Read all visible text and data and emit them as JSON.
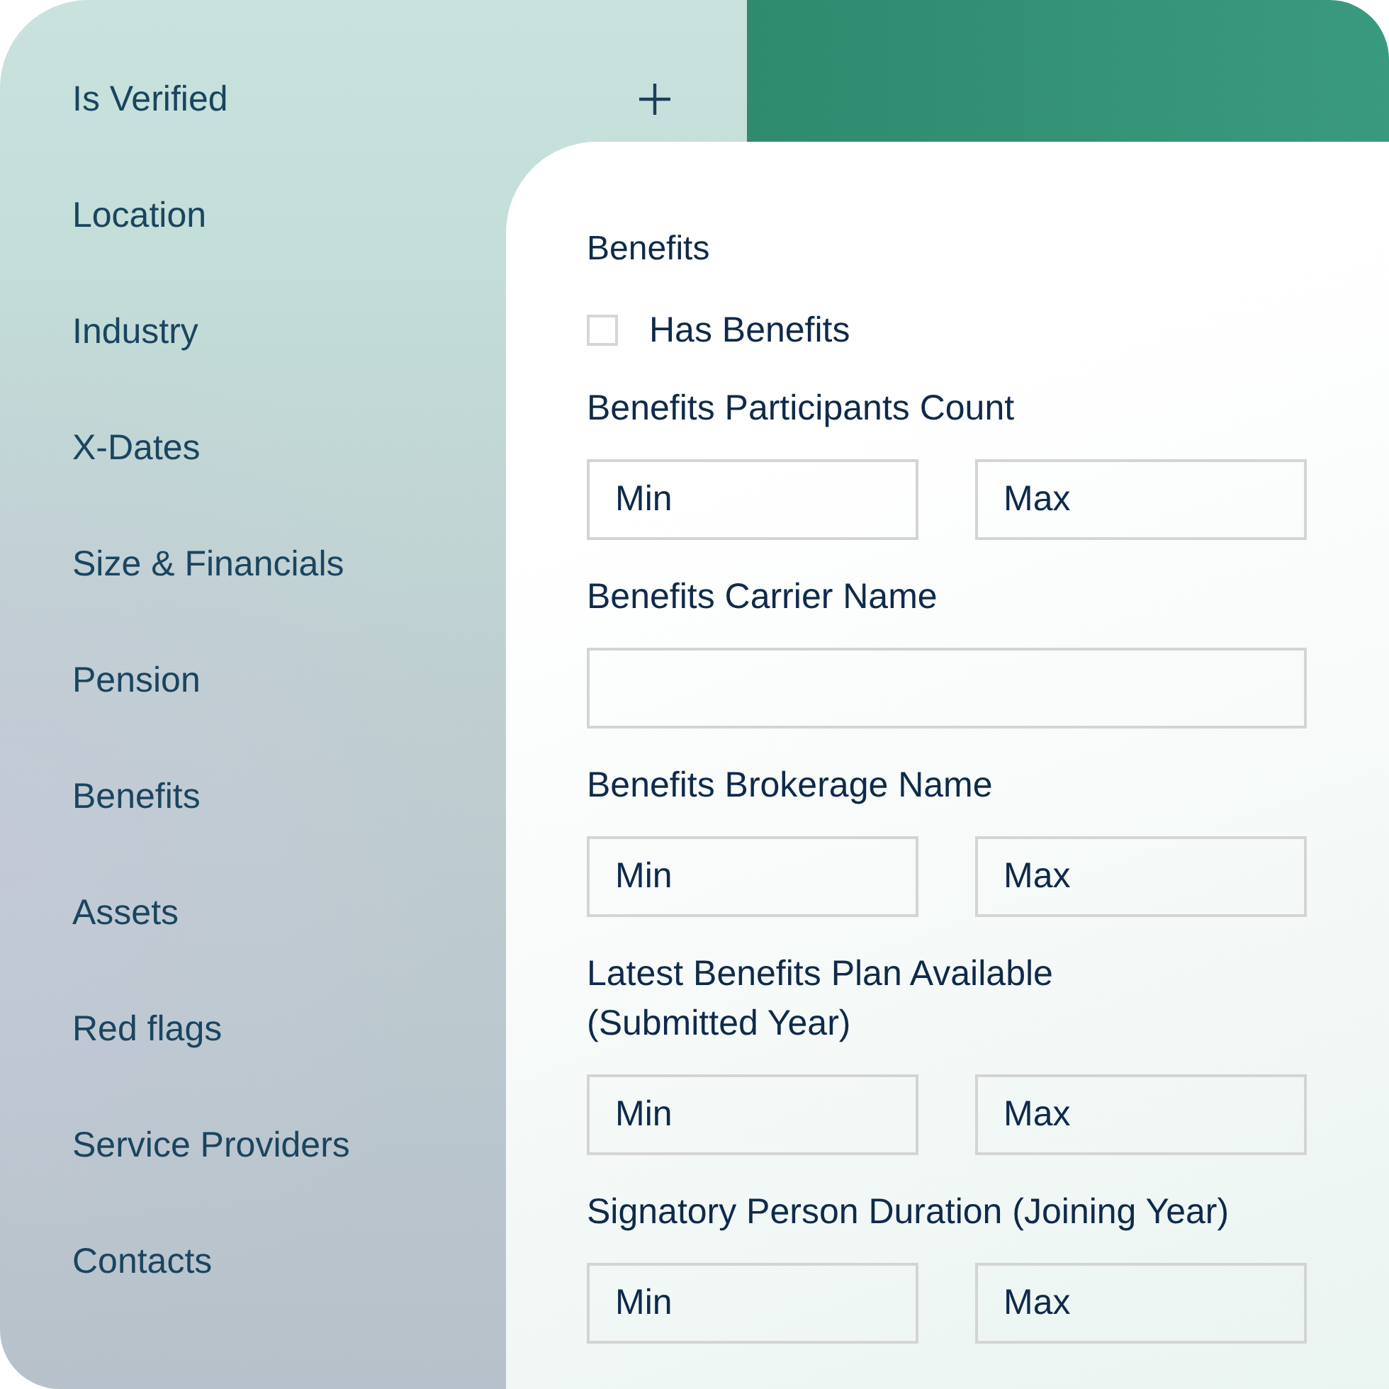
{
  "sidebar": {
    "items": [
      "Is Verified",
      "Location",
      "Industry",
      "X-Dates",
      "Size & Financials",
      "Pension",
      "Benefits",
      "Assets",
      "Red flags",
      "Service Providers",
      "Contacts"
    ]
  },
  "form": {
    "title": "Benefits",
    "checkbox": {
      "label": "Has Benefits",
      "checked": false
    },
    "fields": [
      {
        "kind": "range",
        "label": "Benefits Participants Count",
        "min": {
          "placeholder": "Min"
        },
        "max": {
          "placeholder": "Max"
        }
      },
      {
        "kind": "text",
        "label": "Benefits Carrier Name"
      },
      {
        "kind": "range",
        "label": "Benefits Brokerage Name",
        "min": {
          "placeholder": "Min"
        },
        "max": {
          "placeholder": "Max"
        }
      },
      {
        "kind": "range",
        "label": "Latest Benefits Plan Available\n(Submitted Year)",
        "min": {
          "placeholder": "Min"
        },
        "max": {
          "placeholder": "Max"
        }
      },
      {
        "kind": "range",
        "label": "Signatory Person Duration (Joining Year)",
        "min": {
          "placeholder": "Min"
        },
        "max": {
          "placeholder": "Max"
        }
      }
    ]
  }
}
